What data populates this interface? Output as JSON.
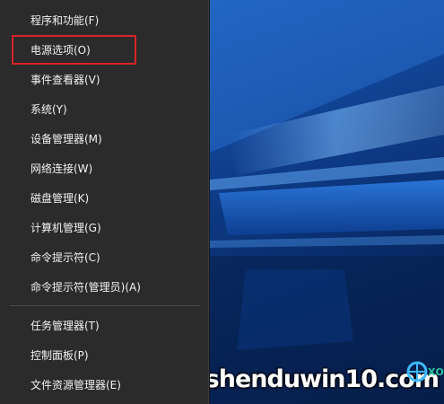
{
  "menu": {
    "items": [
      {
        "label": "程序和功能(F)"
      },
      {
        "label": "电源选项(O)"
      },
      {
        "label": "事件查看器(V)"
      },
      {
        "label": "系统(Y)"
      },
      {
        "label": "设备管理器(M)"
      },
      {
        "label": "网络连接(W)"
      },
      {
        "label": "磁盘管理(K)"
      },
      {
        "label": "计算机管理(G)"
      },
      {
        "label": "命令提示符(C)"
      },
      {
        "label": "命令提示符(管理员)(A)"
      },
      {
        "label": "任务管理器(T)"
      },
      {
        "label": "控制面板(P)"
      },
      {
        "label": "文件资源管理器(E)"
      }
    ],
    "highlighted_item": "电源选项(O)",
    "highlight_color": "#d8232a"
  },
  "watermark": {
    "text": "shenduwin10.com",
    "logo_icon": "globe-logo-icon"
  },
  "colors": {
    "menu_bg": "#2b2b2b",
    "menu_text": "#f2f2f2",
    "wallpaper_blue": "#0f3f8e"
  }
}
